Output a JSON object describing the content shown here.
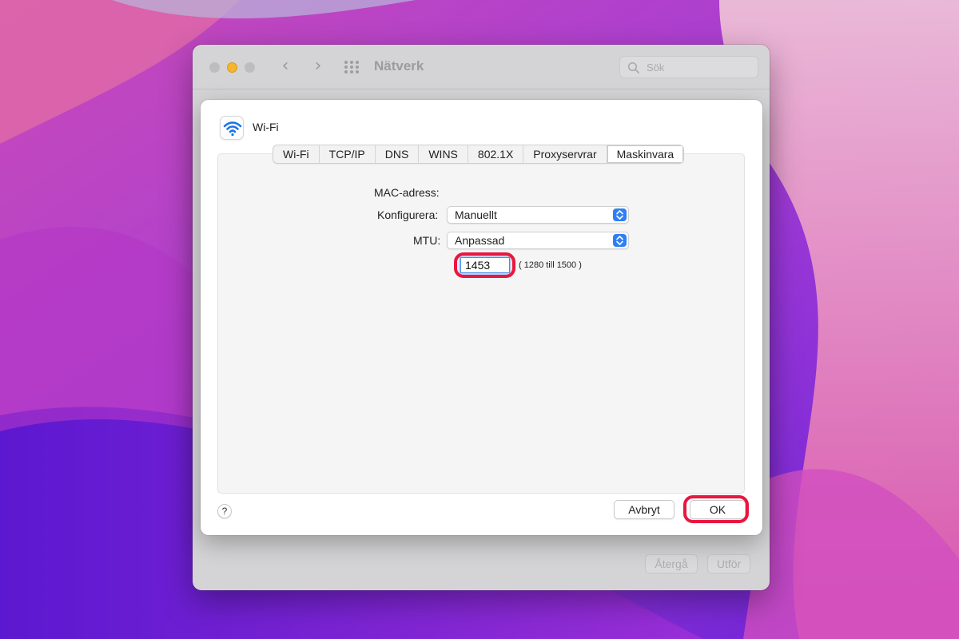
{
  "window": {
    "title": "Nätverk",
    "search_placeholder": "Sök",
    "revert_label": "Återgå",
    "apply_label": "Utför"
  },
  "sheet": {
    "service_name": "Wi-Fi",
    "tabs": [
      {
        "label": "Wi-Fi"
      },
      {
        "label": "TCP/IP"
      },
      {
        "label": "DNS"
      },
      {
        "label": "WINS"
      },
      {
        "label": "802.1X"
      },
      {
        "label": "Proxyservrar"
      },
      {
        "label": "Maskinvara",
        "active": true
      }
    ],
    "fields": {
      "mac_label": "MAC-adress:",
      "configure_label": "Konfigurera:",
      "configure_value": "Manuellt",
      "mtu_label": "MTU:",
      "mtu_value": "Anpassad",
      "mtu_input": "1453",
      "mtu_range": "( 1280 till 1500 )"
    },
    "help_label": "?",
    "cancel_label": "Avbryt",
    "ok_label": "OK"
  },
  "colors": {
    "highlight": "#e8173f",
    "accent": "#2d7ff5",
    "minimize": "#f6b52c"
  }
}
